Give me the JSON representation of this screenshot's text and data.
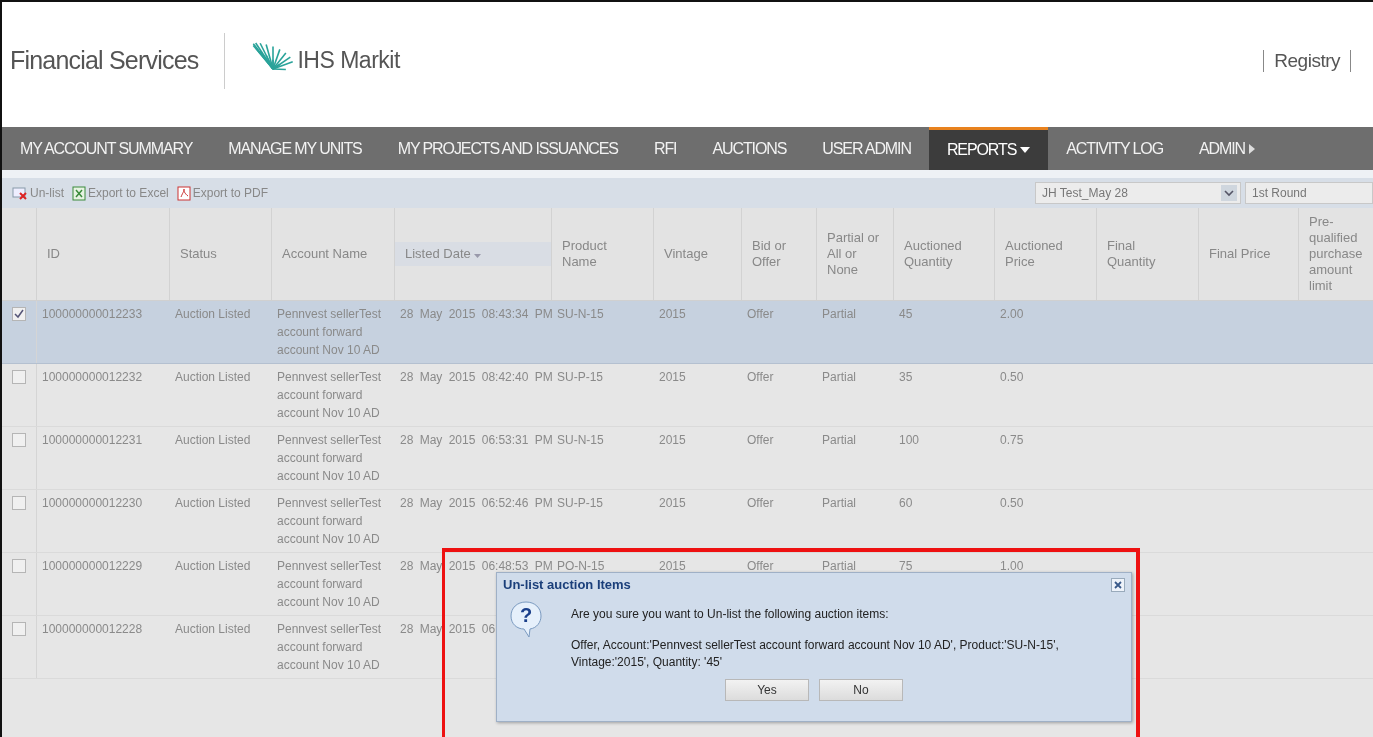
{
  "header": {
    "brand": "Financial Services",
    "logo_text": "IHS Markit",
    "links": [
      "Registry"
    ]
  },
  "nav": [
    {
      "label": "MY ACCOUNT SUMMARY",
      "selected": false,
      "kind": "plain"
    },
    {
      "label": "MANAGE MY UNITS",
      "selected": false,
      "kind": "plain"
    },
    {
      "label": "MY PROJECTS AND ISSUANCES",
      "selected": false,
      "kind": "plain"
    },
    {
      "label": "RFI",
      "selected": false,
      "kind": "plain"
    },
    {
      "label": "AUCTIONS",
      "selected": false,
      "kind": "plain"
    },
    {
      "label": "USER ADMIN",
      "selected": false,
      "kind": "plain"
    },
    {
      "label": "REPORTS",
      "selected": true,
      "kind": "dropdown"
    },
    {
      "label": "ACTIVITY LOG",
      "selected": false,
      "kind": "plain"
    },
    {
      "label": "ADMIN",
      "selected": false,
      "kind": "submenu"
    }
  ],
  "toolbar": {
    "actions": [
      {
        "label": "Un-list",
        "kind": "unlist"
      },
      {
        "label": "Export to Excel",
        "kind": "excel"
      },
      {
        "label": "Export to PDF",
        "kind": "pdf"
      }
    ],
    "auction_select": {
      "value": "JH Test_May 28"
    },
    "round_select": {
      "value": "1st Round"
    }
  },
  "table": {
    "columns": [
      {
        "label": "ID",
        "sorted": false
      },
      {
        "label": "Status",
        "sorted": false
      },
      {
        "label": "Account Name",
        "sorted": false
      },
      {
        "label": "Listed Date",
        "sorted": true
      },
      {
        "label": "Product Name",
        "sorted": false
      },
      {
        "label": "Vintage",
        "sorted": false
      },
      {
        "label": "Bid or Offer",
        "sorted": false
      },
      {
        "label": "Partial or All or None",
        "sorted": false
      },
      {
        "label": "Auctioned Quantity",
        "sorted": false
      },
      {
        "label": "Auctioned Price",
        "sorted": false
      },
      {
        "label": "Final Quantity",
        "sorted": false
      },
      {
        "label": "Final Price",
        "sorted": false
      },
      {
        "label": "Pre-qualified purchase amount limit",
        "sorted": false
      }
    ],
    "rows": [
      {
        "checked": true,
        "selected": true,
        "cells": [
          "100000000012233",
          "Auction Listed",
          "Pennvest sellerTest account forward account Nov 10 AD",
          "28 May 2015 08:43:34 PM",
          "SU-N-15",
          "2015",
          "Offer",
          "Partial",
          "45",
          "2.00"
        ]
      },
      {
        "checked": false,
        "selected": false,
        "cells": [
          "100000000012232",
          "Auction Listed",
          "Pennvest sellerTest account forward account Nov 10 AD",
          "28 May 2015 08:42:40 PM",
          "SU-P-15",
          "2015",
          "Offer",
          "Partial",
          "35",
          "0.50"
        ]
      },
      {
        "checked": false,
        "selected": false,
        "cells": [
          "100000000012231",
          "Auction Listed",
          "Pennvest sellerTest account forward account Nov 10 AD",
          "28 May 2015 06:53:31 PM",
          "SU-N-15",
          "2015",
          "Offer",
          "Partial",
          "100",
          "0.75"
        ]
      },
      {
        "checked": false,
        "selected": false,
        "cells": [
          "100000000012230",
          "Auction Listed",
          "Pennvest sellerTest account forward account Nov 10 AD",
          "28 May 2015 06:52:46 PM",
          "SU-P-15",
          "2015",
          "Offer",
          "Partial",
          "60",
          "0.50"
        ]
      },
      {
        "checked": false,
        "selected": false,
        "cells": [
          "100000000012229",
          "Auction Listed",
          "Pennvest sellerTest account forward account Nov 10 AD",
          "28 May 2015 06:48:53 PM",
          "PO-N-15",
          "2015",
          "Offer",
          "Partial",
          "75",
          "1.00"
        ]
      },
      {
        "checked": false,
        "selected": false,
        "cells": [
          "100000000012228",
          "Auction Listed",
          "Pennvest sellerTest account forward account Nov 10 AD",
          "28 May 2015 06"
        ]
      }
    ]
  },
  "dialog": {
    "title": "Un-list auction Items",
    "icon_glyph": "?",
    "question": "Are you sure you want to Un-list the following auction items:",
    "details": "Offer, Account:'Pennvest sellerTest account forward account Nov 10 AD', Product:'SU-N-15', Vintage:'2015', Quantity: '45'",
    "buttons": [
      "Yes",
      "No"
    ]
  }
}
